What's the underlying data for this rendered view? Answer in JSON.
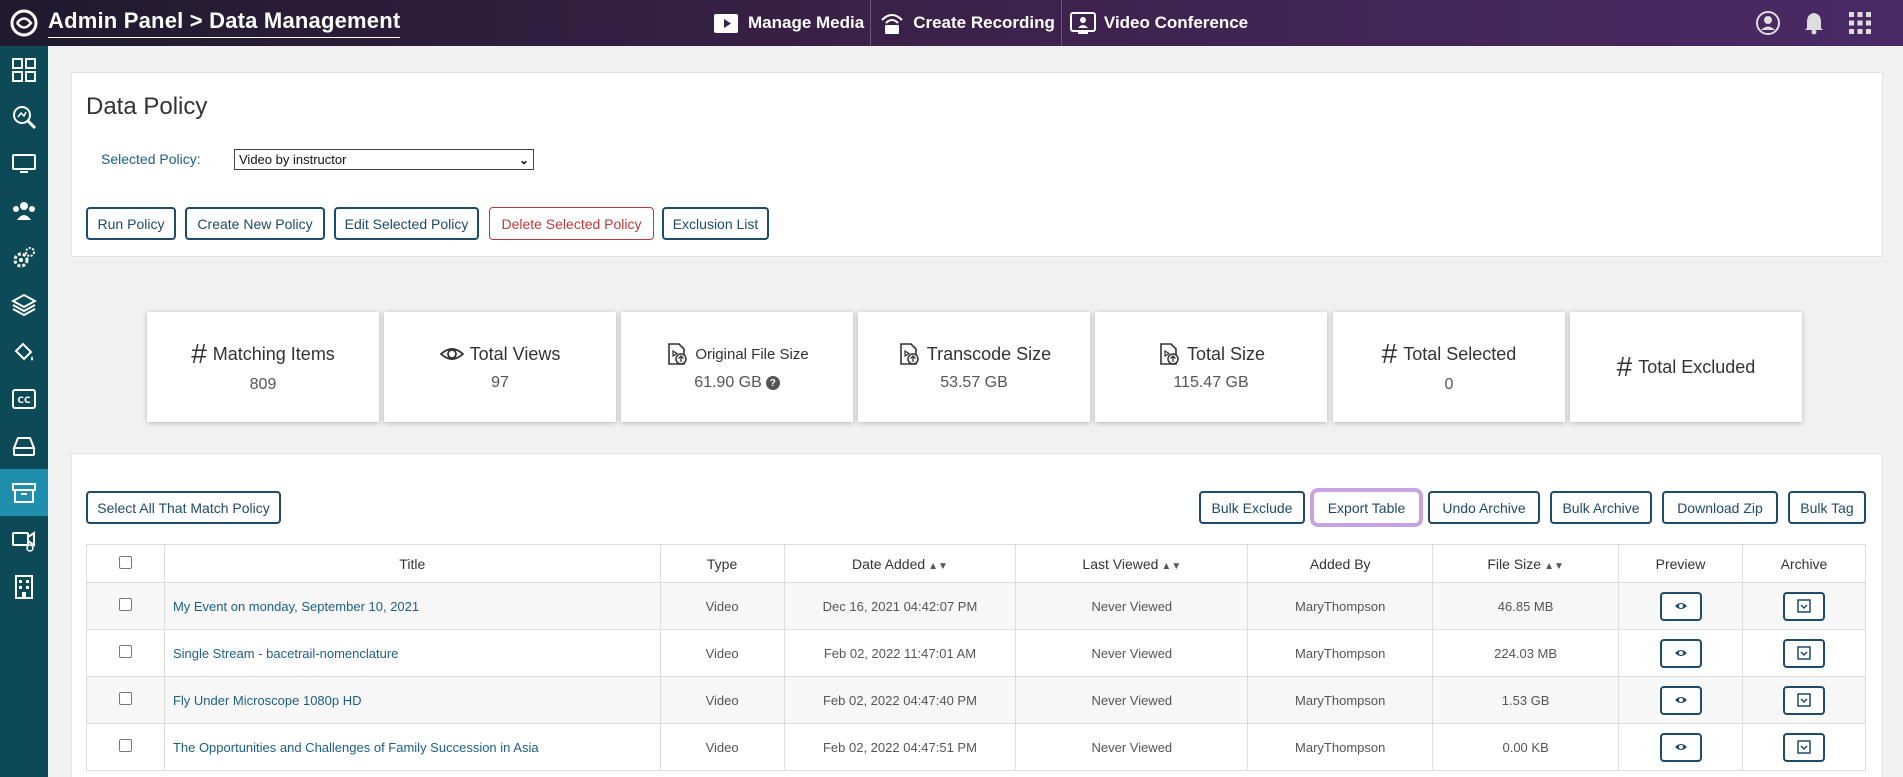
{
  "header": {
    "breadcrumb": "Admin Panel > Data Management",
    "actions": [
      {
        "label": "Manage Media",
        "icon": "media-icon"
      },
      {
        "label": "Create Recording",
        "icon": "recording-icon"
      },
      {
        "label": "Video Conference",
        "icon": "conference-icon"
      }
    ],
    "right_icons": [
      "user-icon",
      "bell-icon",
      "apps-grid-icon"
    ]
  },
  "sidebar": {
    "items": [
      {
        "icon": "dashboard-icon"
      },
      {
        "icon": "search-analytics-icon"
      },
      {
        "icon": "monitor-icon"
      },
      {
        "icon": "users-group-icon"
      },
      {
        "icon": "settings-gears-icon"
      },
      {
        "icon": "layers-icon"
      },
      {
        "icon": "paint-bucket-icon"
      },
      {
        "icon": "closed-captions-icon"
      },
      {
        "icon": "storage-drive-icon"
      },
      {
        "icon": "archive-box-icon",
        "active": true
      },
      {
        "icon": "video-settings-icon"
      },
      {
        "icon": "building-icon"
      }
    ]
  },
  "policy": {
    "title": "Data Policy",
    "selected_label": "Selected Policy:",
    "selected_value": "Video by instructor",
    "buttons": {
      "run": "Run Policy",
      "create": "Create New Policy",
      "edit": "Edit Selected Policy",
      "delete": "Delete Selected Policy",
      "exclusion": "Exclusion List"
    }
  },
  "stats": {
    "matching": {
      "label": "Matching Items",
      "value": "809"
    },
    "views": {
      "label": "Total Views",
      "value": "97"
    },
    "original": {
      "label": "Original File Size",
      "value": "61.90 GB"
    },
    "transcode": {
      "label": "Transcode Size",
      "value": "53.57 GB"
    },
    "total_size": {
      "label": "Total Size",
      "value": "115.47 GB"
    },
    "selected": {
      "label": "Total Selected",
      "value": "0"
    },
    "excluded": {
      "label": "Total Excluded",
      "value": ""
    }
  },
  "table_toolbar": {
    "select_all": "Select All That Match Policy",
    "bulk_exclude": "Bulk Exclude",
    "export": "Export Table",
    "undo_archive": "Undo Archive",
    "bulk_archive": "Bulk Archive",
    "download_zip": "Download Zip",
    "bulk_tag": "Bulk Tag"
  },
  "table": {
    "columns": [
      "Title",
      "Type",
      "Date Added",
      "Last Viewed",
      "Added By",
      "File Size",
      "Preview",
      "Archive"
    ],
    "rows": [
      {
        "title": "My Event on monday, September 10, 2021",
        "type": "Video",
        "date": "Dec 16, 2021 04:42:07 PM",
        "viewed": "Never Viewed",
        "by": "MaryThompson",
        "size": "46.85 MB"
      },
      {
        "title": "Single Stream - bacetrail-nomenclature",
        "type": "Video",
        "date": "Feb 02, 2022 11:47:01 AM",
        "viewed": "Never Viewed",
        "by": "MaryThompson",
        "size": "224.03 MB"
      },
      {
        "title": "Fly Under Microscope 1080p HD",
        "type": "Video",
        "date": "Feb 02, 2022 04:47:40 PM",
        "viewed": "Never Viewed",
        "by": "MaryThompson",
        "size": "1.53 GB"
      },
      {
        "title": "The Opportunities and Challenges of Family Succession in Asia",
        "type": "Video",
        "date": "Feb 02, 2022 04:47:51 PM",
        "viewed": "Never Viewed",
        "by": "MaryThompson",
        "size": "0.00 KB"
      }
    ]
  }
}
